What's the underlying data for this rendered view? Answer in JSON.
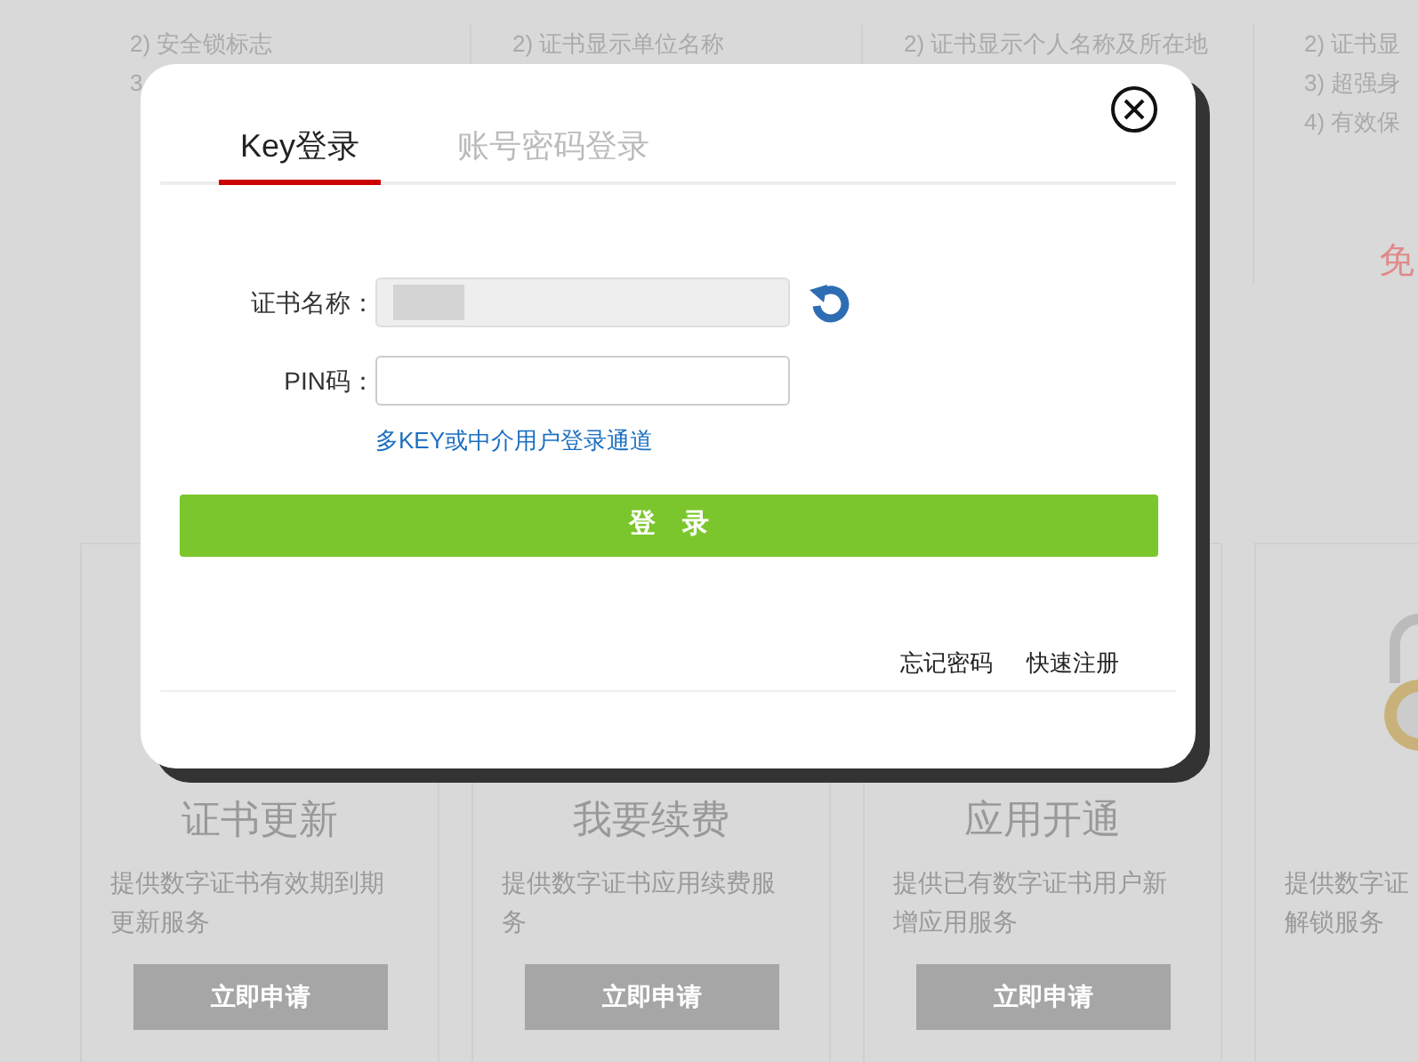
{
  "background": {
    "feature_columns": [
      {
        "lines": [
          "2) 安全锁标志",
          "3"
        ]
      },
      {
        "lines": [
          "2) 证书显示单位名称"
        ]
      },
      {
        "lines": [
          "2) 证书显示个人名称及所在地"
        ]
      },
      {
        "lines": [
          "2) 证书显",
          "3) 超强身",
          "4) 有效保"
        ],
        "note": "免"
      }
    ],
    "service_cards": [
      {
        "title": "证书更新",
        "description_lines": [
          "提供数字证书有效期到期",
          "更新服务"
        ],
        "button": "立即申请"
      },
      {
        "title": "我要续费",
        "description_lines": [
          "提供数字证书应用续费服",
          "务"
        ],
        "button": "立即申请"
      },
      {
        "title": "应用开通",
        "description_lines": [
          "提供已有数字证书用户新",
          "增应用服务"
        ],
        "button": "立即申请"
      },
      {
        "description_lines": [
          "提供数字证",
          "解锁服务"
        ]
      }
    ]
  },
  "login_dialog": {
    "tabs": [
      {
        "label": "Key登录",
        "selected": true
      },
      {
        "label": "账号密码登录",
        "selected": false
      }
    ],
    "fields": [
      {
        "label": "证书名称：",
        "kind": "readonly",
        "redacted": true
      },
      {
        "label": "PIN码：",
        "kind": "input"
      }
    ],
    "alt_login_link": "多KEY或中介用户登录通道",
    "submit_button": "登　录",
    "footer_links": [
      "忘记密码",
      "快速注册"
    ]
  }
}
